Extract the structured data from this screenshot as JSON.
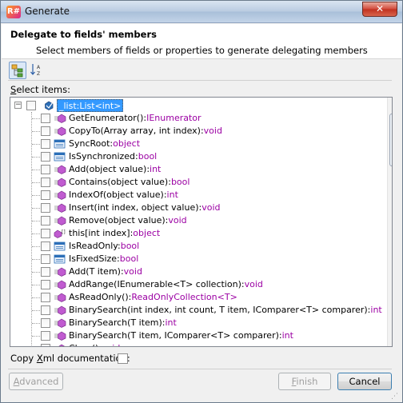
{
  "window": {
    "title": "Generate",
    "app_icon_text": "R#",
    "close_symbol": "✕"
  },
  "header": {
    "title": "Delegate to fields' members",
    "subtitle": "Select members of fields or properties to generate delegating members"
  },
  "toolbar": {
    "buttons": [
      "group-by-type",
      "sort-alphabetically"
    ]
  },
  "select_label": {
    "prefix": "S",
    "rest": "elect items:"
  },
  "tree": {
    "root": {
      "name": "_list:List<int>",
      "checked": false,
      "expanded": true
    },
    "items": [
      {
        "kind": "method",
        "name": "GetEnumerator():",
        "type": "IEnumerator"
      },
      {
        "kind": "method",
        "name": "CopyTo(Array array, int index):",
        "type": "void"
      },
      {
        "kind": "property",
        "name": "SyncRoot:",
        "type": "object"
      },
      {
        "kind": "property",
        "name": "IsSynchronized:",
        "type": "bool"
      },
      {
        "kind": "method",
        "name": "Add(object value):",
        "type": "int"
      },
      {
        "kind": "method",
        "name": "Contains(object value):",
        "type": "bool"
      },
      {
        "kind": "method",
        "name": "IndexOf(object value):",
        "type": "int"
      },
      {
        "kind": "method",
        "name": "Insert(int index, object value):",
        "type": "void"
      },
      {
        "kind": "method",
        "name": "Remove(object value):",
        "type": "void"
      },
      {
        "kind": "indexer",
        "name": "this[int index]:",
        "type": "object"
      },
      {
        "kind": "property",
        "name": "IsReadOnly:",
        "type": "bool"
      },
      {
        "kind": "property",
        "name": "IsFixedSize:",
        "type": "bool"
      },
      {
        "kind": "method",
        "name": "Add(T item):",
        "type": "void"
      },
      {
        "kind": "method",
        "name": "AddRange(IEnumerable<T> collection):",
        "type": "void"
      },
      {
        "kind": "method",
        "name": "AsReadOnly():",
        "type": "ReadOnlyCollection<T>"
      },
      {
        "kind": "method",
        "name": "BinarySearch(int index, int count, T item, IComparer<T> comparer):",
        "type": "int"
      },
      {
        "kind": "method",
        "name": "BinarySearch(T item):",
        "type": "int"
      },
      {
        "kind": "method",
        "name": "BinarySearch(T item, IComparer<T> comparer):",
        "type": "int"
      },
      {
        "kind": "method",
        "name": "Clear():",
        "type": "void"
      }
    ]
  },
  "copy_xml": {
    "prefix": "Copy ",
    "underlined": "X",
    "rest": "ml documentation:",
    "checked": false
  },
  "buttons": {
    "advanced": {
      "prefix": "A",
      "rest": "dvanced",
      "enabled": false
    },
    "finish": {
      "prefix": "F",
      "rest": "inish",
      "enabled": false
    },
    "cancel": {
      "label": "Cancel",
      "enabled": true
    }
  },
  "colors": {
    "type_color": "#9b00a3",
    "selection": "#3399ff",
    "method_icon": "#c05bd0",
    "property_icon": "#2c6fb8"
  }
}
